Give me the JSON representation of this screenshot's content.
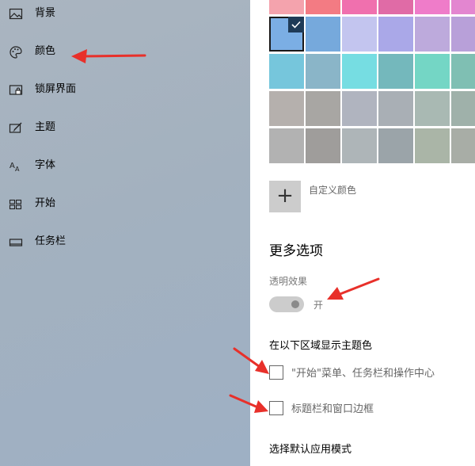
{
  "sidebar": {
    "items": [
      {
        "label": "背景",
        "icon": "picture-icon"
      },
      {
        "label": "颜色",
        "icon": "palette-icon"
      },
      {
        "label": "锁屏界面",
        "icon": "lock-screen-icon"
      },
      {
        "label": "主题",
        "icon": "theme-icon"
      },
      {
        "label": "字体",
        "icon": "font-icon"
      },
      {
        "label": "开始",
        "icon": "start-icon"
      },
      {
        "label": "任务栏",
        "icon": "taskbar-icon"
      }
    ]
  },
  "palette": {
    "rows": [
      [
        "#f4a3ad",
        "#f37b83",
        "#f070ae",
        "#e06ba6",
        "#ef7cc9",
        "#e386d0"
      ],
      [
        "#7baee4",
        "#76a9dc",
        "#c3c5ef",
        "#aaa8e8",
        "#bdaadc",
        "#b8a0d9"
      ],
      [
        "#76c6dc",
        "#8ab5c8",
        "#76dde2",
        "#74b8bc",
        "#74d6c5",
        "#7fbfb3"
      ],
      [
        "#b5b0ad",
        "#a8a6a3",
        "#b0b4bf",
        "#a9afb5",
        "#a9b9b3",
        "#9fb1aa"
      ],
      [
        "#b2b2b2",
        "#9f9d9b",
        "#aeb5b8",
        "#9ba4a9",
        "#aab5a7",
        "#a8ada6"
      ]
    ],
    "selected_color": "#7baee4"
  },
  "custom_color": {
    "plus": "+",
    "label": "自定义颜色"
  },
  "more_options": {
    "title": "更多选项",
    "transparency_label": "透明效果",
    "transparency_state": "开",
    "transparency_on": true
  },
  "accent_surfaces": {
    "heading": "在以下区域显示主题色",
    "options": [
      {
        "label": "\"开始\"菜单、任务栏和操作中心",
        "checked": false
      },
      {
        "label": "标题栏和窗口边框",
        "checked": false
      }
    ]
  },
  "app_mode": {
    "heading": "选择默认应用模式"
  },
  "colors": {
    "annotation_arrow": "#e8302a",
    "sidebar_tint": "#a3b1bf"
  }
}
